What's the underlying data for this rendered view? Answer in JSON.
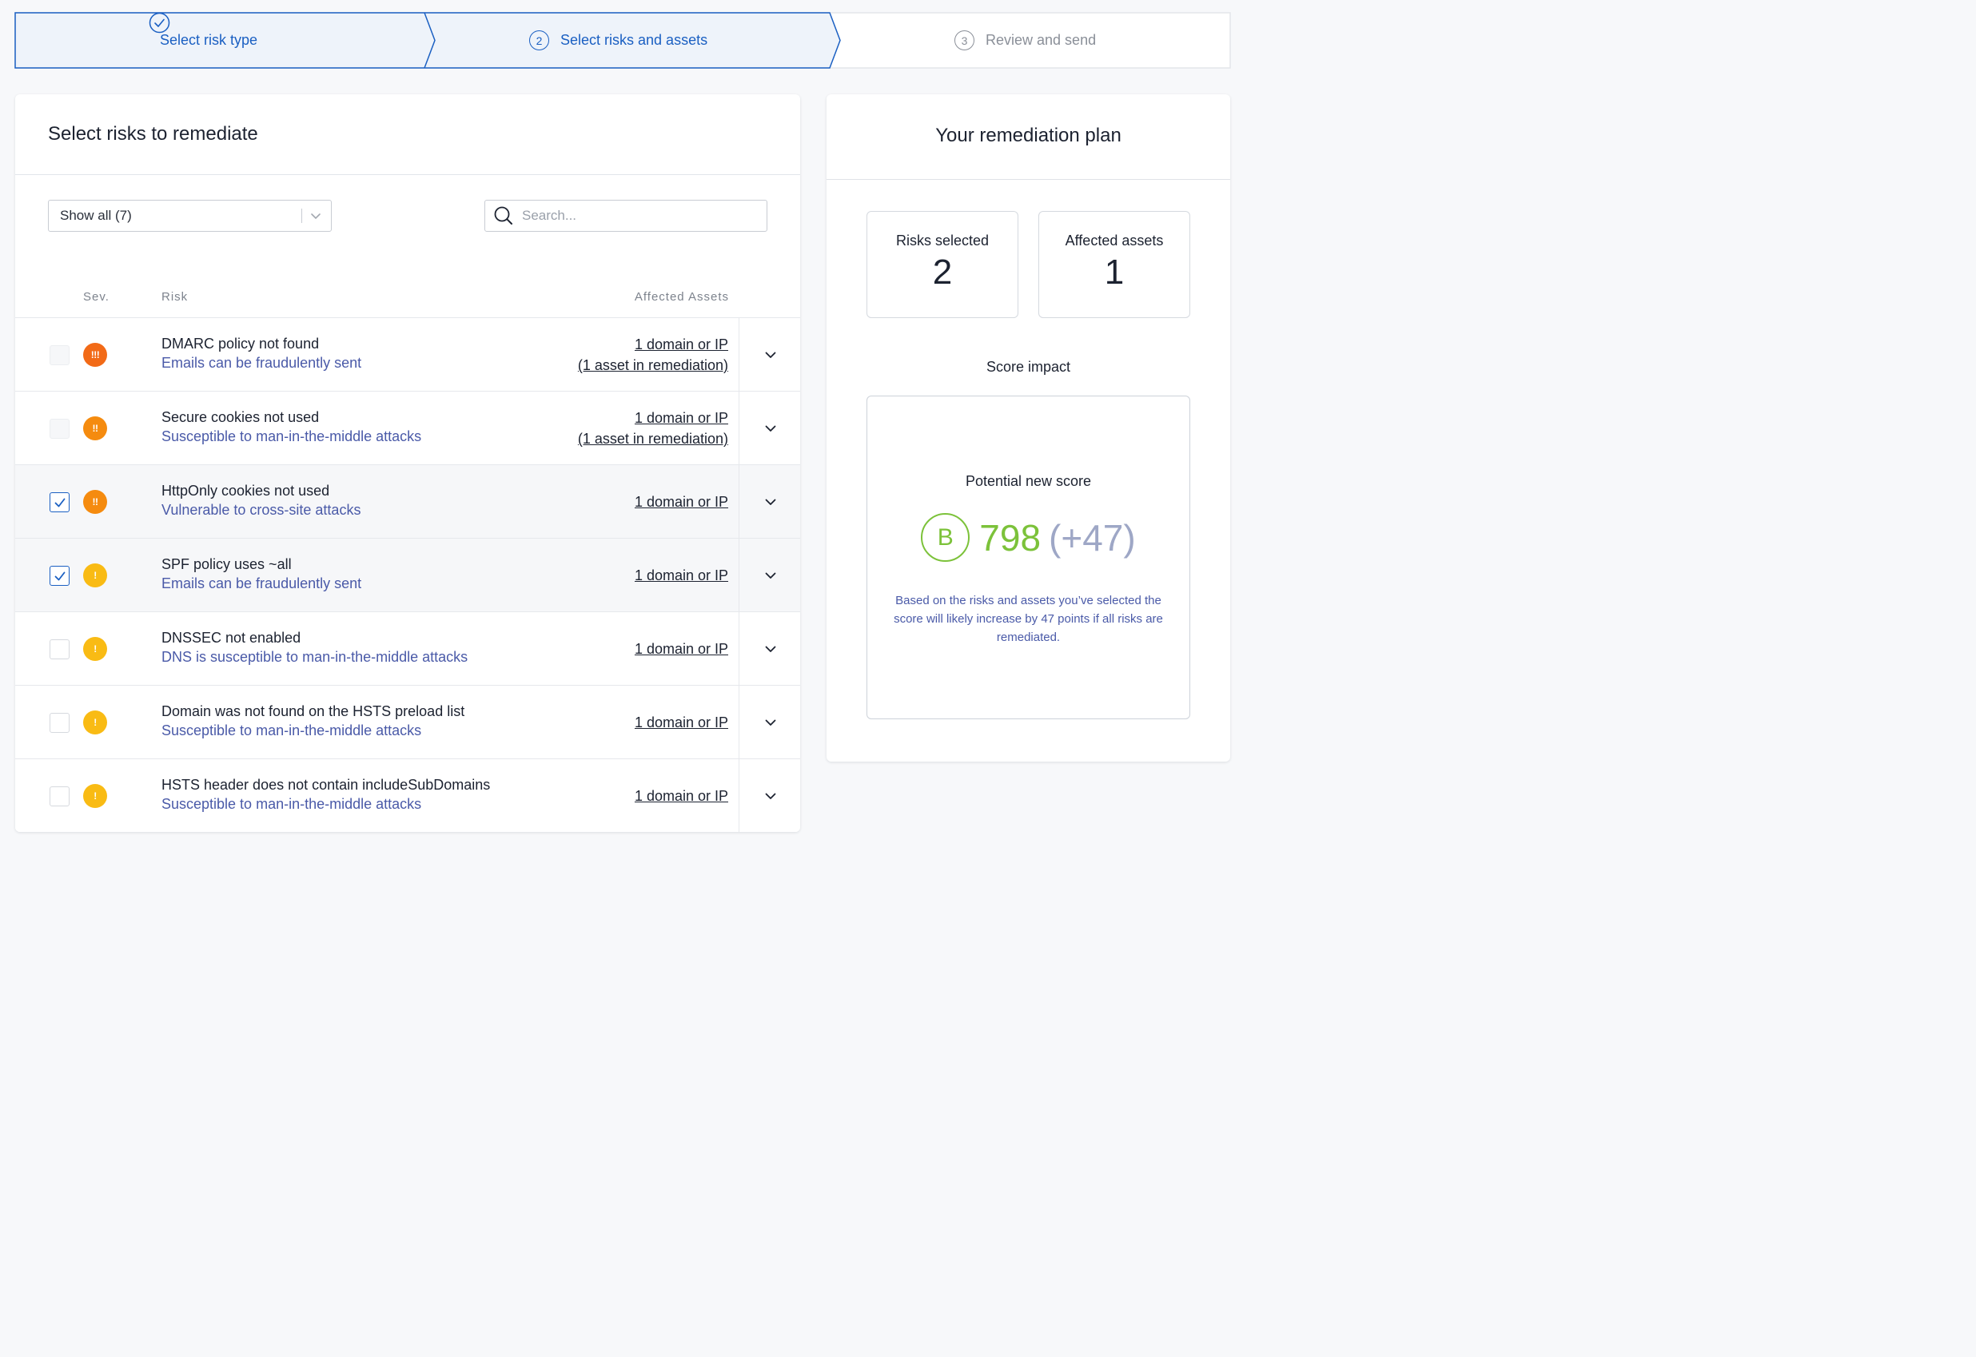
{
  "stepper": {
    "steps": [
      {
        "number": "1",
        "label": "Select risk type",
        "state": "complete"
      },
      {
        "number": "2",
        "label": "Select risks and assets",
        "state": "active"
      },
      {
        "number": "3",
        "label": "Review and send",
        "state": "pending"
      }
    ]
  },
  "colors": {
    "accent": "#1a5fc2",
    "critical": "#f26a17",
    "high": "#f58b0f",
    "medium": "#f9bb14",
    "score_green": "#7cc23a",
    "description_blue": "#4a5aa8"
  },
  "left_panel": {
    "title": "Select risks to remediate",
    "filter": {
      "selected": "Show all (7)"
    },
    "search": {
      "placeholder": "Search...",
      "value": ""
    },
    "columns": {
      "severity": "Sev.",
      "risk": "Risk",
      "assets": "Affected Assets"
    },
    "rows": [
      {
        "title": "DMARC policy not found",
        "desc": "Emails can be fraudulently sent",
        "severity": "critical",
        "severity_icon": "!!!",
        "checked": false,
        "disabled": true,
        "assets": [
          "1 domain or IP",
          "(1 asset in remediation)"
        ]
      },
      {
        "title": "Secure cookies not used",
        "desc": "Susceptible to man-in-the-middle attacks",
        "severity": "high",
        "severity_icon": "!!",
        "checked": false,
        "disabled": true,
        "assets": [
          "1 domain or IP",
          "(1 asset in remediation)"
        ]
      },
      {
        "title": "HttpOnly cookies not used",
        "desc": "Vulnerable to cross-site attacks",
        "severity": "high",
        "severity_icon": "!!",
        "checked": true,
        "disabled": false,
        "assets": [
          "1 domain or IP"
        ]
      },
      {
        "title": "SPF policy uses ~all",
        "desc": "Emails can be fraudulently sent",
        "severity": "medium",
        "severity_icon": "!",
        "checked": true,
        "disabled": false,
        "assets": [
          "1 domain or IP"
        ]
      },
      {
        "title": "DNSSEC not enabled",
        "desc": "DNS is susceptible to man-in-the-middle attacks",
        "severity": "medium",
        "severity_icon": "!",
        "checked": false,
        "disabled": false,
        "assets": [
          "1 domain or IP"
        ]
      },
      {
        "title": "Domain was not found on the HSTS preload list",
        "desc": "Susceptible to man-in-the-middle attacks",
        "severity": "medium",
        "severity_icon": "!",
        "checked": false,
        "disabled": false,
        "assets": [
          "1 domain or IP"
        ]
      },
      {
        "title": "HSTS header does not contain includeSubDomains",
        "desc": "Susceptible to man-in-the-middle attacks",
        "severity": "medium",
        "severity_icon": "!",
        "checked": false,
        "disabled": false,
        "assets": [
          "1 domain or IP"
        ]
      }
    ]
  },
  "right_panel": {
    "title": "Your remediation plan",
    "risks_selected": {
      "label": "Risks selected",
      "value": "2"
    },
    "affected_assets": {
      "label": "Affected assets",
      "value": "1"
    },
    "impact_label": "Score impact",
    "potential_label": "Potential new score",
    "grade": "B",
    "score": "798",
    "delta": "(+47)",
    "explanation": "Based on the risks and assets you’ve selected the score will likely increase by 47 points if all risks are remediated."
  }
}
